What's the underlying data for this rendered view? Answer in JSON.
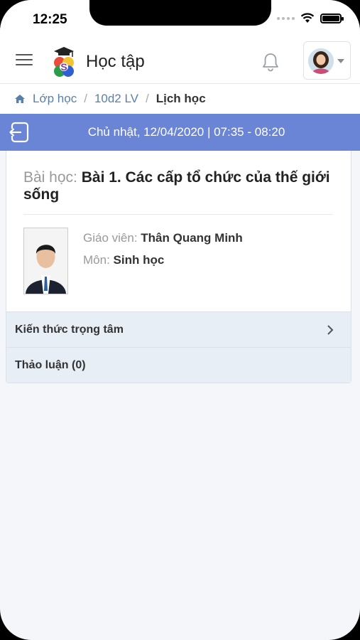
{
  "status_bar": {
    "time": "12:25"
  },
  "header": {
    "title": "Học tập"
  },
  "breadcrumb": {
    "items": [
      "Lớp học",
      "10d2 LV"
    ],
    "current": "Lịch học"
  },
  "date_bar": {
    "text": "Chủ nhật, 12/04/2020 | 07:35 - 08:20"
  },
  "lesson": {
    "label": "Bài học:",
    "name": "Bài 1. Các cấp tổ chức của thế giới sống",
    "teacher_label": "Giáo viên:",
    "teacher_name": "Thân Quang Minh",
    "subject_label": "Môn:",
    "subject_name": "Sinh học"
  },
  "sections": [
    {
      "label": "Kiến thức trọng tâm"
    },
    {
      "label": "Thảo luận (0)"
    }
  ],
  "colors": {
    "accent": "#6a84d6",
    "link": "#5a7fa8",
    "section_bg": "#e8eef6"
  },
  "icons": [
    "hamburger-icon",
    "app-logo",
    "bell-icon",
    "user-avatar",
    "home-icon",
    "back-icon",
    "chevron-right-icon"
  ]
}
